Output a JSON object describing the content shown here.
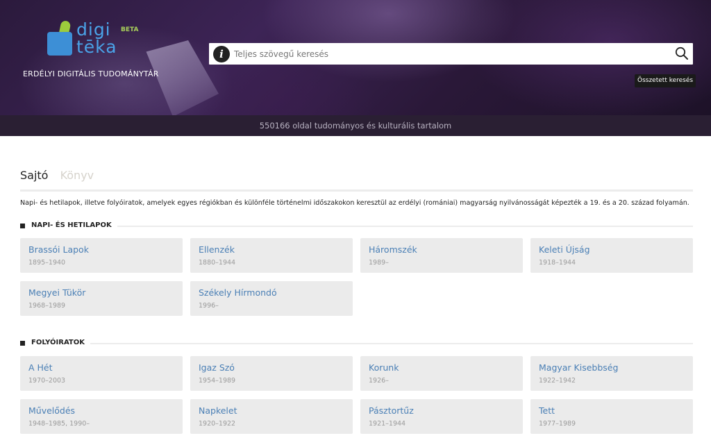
{
  "header": {
    "logo_text_1": "digi",
    "logo_text_2": "tēka",
    "logo_badge": "BETA",
    "tagline": "ERDÉLYI DIGITÁLIS TUDOMÁNYTÁR",
    "search_placeholder": "Teljes szövegű keresés",
    "info_glyph": "i",
    "advanced_search_label": "Összetett keresés"
  },
  "stats": {
    "text": "550166 oldal tudományos és kulturális tartalom"
  },
  "tabs": [
    {
      "label": "Sajtó",
      "active": true
    },
    {
      "label": "Könyv",
      "active": false
    }
  ],
  "description": "Napi- és hetilapok, illetve folyóiratok, amelyek egyes régiókban és különféle történelmi időszakokon keresztül az erdélyi (romániai) magyarság nyilvánosságát képezték a 19. és a 20. század folyamán.",
  "sections": [
    {
      "title": "NAPI- ÉS HETILAPOK",
      "items": [
        {
          "name": "Brassói Lapok",
          "years": "1895–1940"
        },
        {
          "name": "Ellenzék",
          "years": "1880–1944"
        },
        {
          "name": "Háromszék",
          "years": "1989–"
        },
        {
          "name": "Keleti Újság",
          "years": "1918–1944"
        },
        {
          "name": "Megyei Tükör",
          "years": "1968–1989"
        },
        {
          "name": "Székely Hírmondó",
          "years": "1996–"
        }
      ]
    },
    {
      "title": "FOLYÓIRATOK",
      "items": [
        {
          "name": "A Hét",
          "years": "1970–2003"
        },
        {
          "name": "Igaz Szó",
          "years": "1954–1989"
        },
        {
          "name": "Korunk",
          "years": "1926–"
        },
        {
          "name": "Magyar Kisebbség",
          "years": "1922–1942"
        },
        {
          "name": "Művelődés",
          "years": "1948–1985, 1990–"
        },
        {
          "name": "Napkelet",
          "years": "1920–1922"
        },
        {
          "name": "Pásztortűz",
          "years": "1921–1944"
        },
        {
          "name": "Tett",
          "years": "1977–1989"
        }
      ]
    }
  ],
  "colors": {
    "link": "#4a7fb5",
    "card_bg": "#ebebeb",
    "stats_bar": "#2a1f33",
    "logo_blue": "#3d8fd6",
    "logo_green": "#9ccc3c"
  }
}
